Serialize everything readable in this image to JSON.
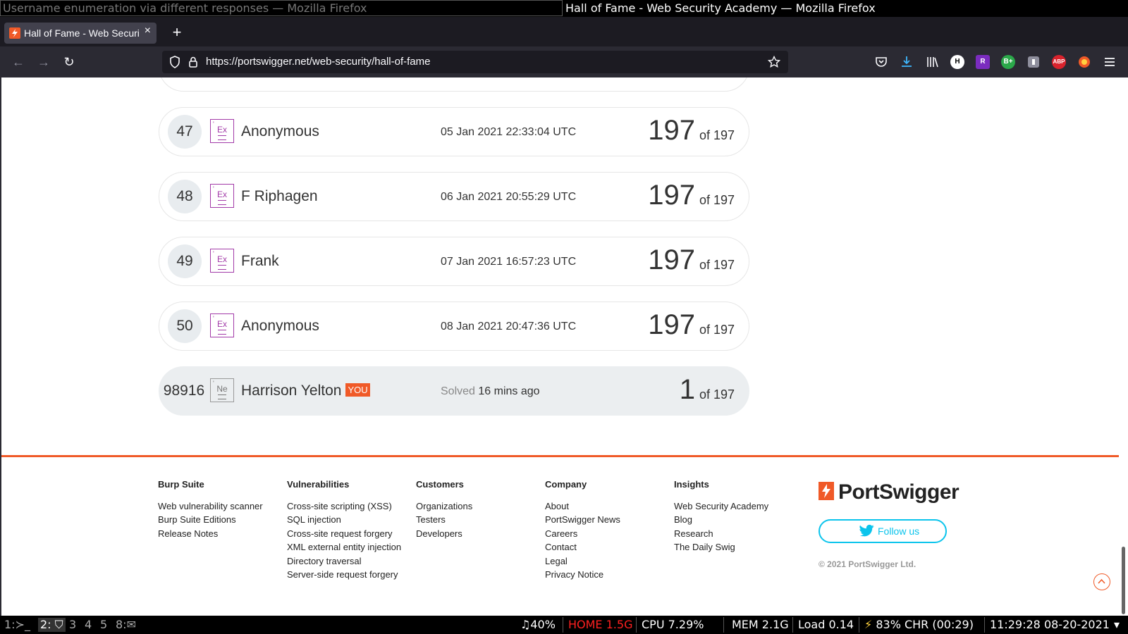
{
  "window": {
    "left_title": "Username enumeration via different responses — Mozilla Firefox",
    "right_title": "Hall of Fame - Web Security Academy — Mozilla Firefox"
  },
  "tab": {
    "title": "Hall of Fame - Web Security Academy",
    "close": "×",
    "new_tab": "+"
  },
  "nav": {
    "url": "https://portswigger.net/web-security/hall-of-fame",
    "back": "←",
    "forward": "→",
    "reload": "↻"
  },
  "extensions": [
    {
      "name": "H",
      "color": "#ffffff"
    },
    {
      "name": "R",
      "color": "#7b2cbf"
    },
    {
      "name": "B+",
      "color": "#2ba84a"
    },
    {
      "name": "ABP",
      "color": "#d9232d"
    }
  ],
  "leaderboard": [
    {
      "rank": "47",
      "badge": "Ex",
      "name": "Anonymous",
      "date": "05 Jan 2021 22:33:04 UTC",
      "score": "197",
      "total": "of 197"
    },
    {
      "rank": "48",
      "badge": "Ex",
      "name": "F Riphagen",
      "date": "06 Jan 2021 20:55:29 UTC",
      "score": "197",
      "total": "of 197"
    },
    {
      "rank": "49",
      "badge": "Ex",
      "name": "Frank",
      "date": "07 Jan 2021 16:57:23 UTC",
      "score": "197",
      "total": "of 197"
    },
    {
      "rank": "50",
      "badge": "Ex",
      "name": "Anonymous",
      "date": "08 Jan 2021 20:47:36 UTC",
      "score": "197",
      "total": "of 197"
    }
  ],
  "you_row": {
    "rank": "98916",
    "badge": "Ne",
    "name": "Harrison Yelton",
    "you_tag": "YOU",
    "solved_label": "Solved",
    "solved_time": "16 mins ago",
    "score": "1",
    "total": "of 197"
  },
  "footer": {
    "columns": [
      {
        "heading": "Burp Suite",
        "links": [
          "Web vulnerability scanner",
          "Burp Suite Editions",
          "Release Notes"
        ]
      },
      {
        "heading": "Vulnerabilities",
        "links": [
          "Cross-site scripting (XSS)",
          "SQL injection",
          "Cross-site request forgery",
          "XML external entity injection",
          "Directory traversal",
          "Server-side request forgery"
        ]
      },
      {
        "heading": "Customers",
        "links": [
          "Organizations",
          "Testers",
          "Developers"
        ]
      },
      {
        "heading": "Company",
        "links": [
          "About",
          "PortSwigger News",
          "Careers",
          "Contact",
          "Legal",
          "Privacy Notice"
        ]
      },
      {
        "heading": "Insights",
        "links": [
          "Web Security Academy",
          "Blog",
          "Research",
          "The Daily Swig"
        ]
      }
    ],
    "logo_text": "PortSwigger",
    "follow_label": "Follow us",
    "copyright": "© 2021 PortSwigger Ltd."
  },
  "statusbar": {
    "workspaces": [
      "1:",
      "2:",
      "3",
      "4",
      "5",
      "8:"
    ],
    "volume": "40%",
    "home": "HOME 1.5G",
    "cpu": "CPU 7.29%",
    "mem": "MEM 2.1G",
    "load": "Load 0.14",
    "battery": "83% CHR (00:29)",
    "clock": "11:29:28 08-20-2021"
  },
  "colors": {
    "accent": "#f05a28",
    "badge_expert": "#a23aa8",
    "twitter": "#0bc4ec",
    "home_warning": "#ff2020"
  }
}
